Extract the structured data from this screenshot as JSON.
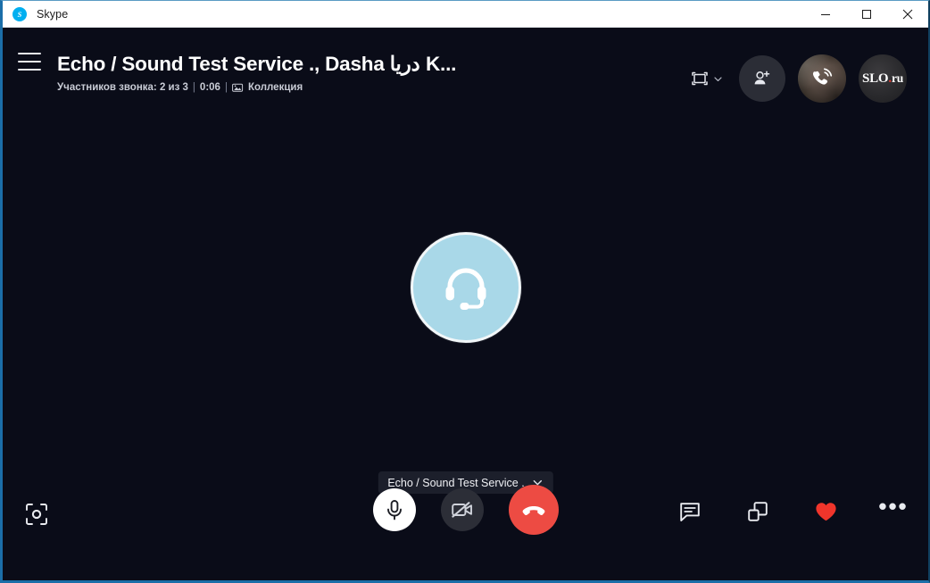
{
  "window": {
    "app_name": "Skype",
    "logo_icon": "skype-logo-icon",
    "controls": {
      "minimize": "minimize-icon",
      "maximize": "maximize-icon",
      "close": "close-icon"
    }
  },
  "header": {
    "menu_icon": "hamburger-menu-icon",
    "call_title": "Echo / Sound Test Service ., Dasha دریا K...",
    "subtitle": {
      "participants": "Участников звонка: 2 из 3",
      "sep1": "|",
      "duration": "0:06",
      "sep2": "|",
      "gallery_icon": "gallery-collection-icon",
      "gallery_label": "Коллекция"
    },
    "actions": {
      "layout_icon": "layout-frame-icon",
      "layout_chevron_icon": "chevron-down-icon",
      "add_people_icon": "add-person-icon",
      "ringing_avatar_icon": "call-ringing-icon",
      "self_avatar_text": "SLO",
      "self_avatar_dot": ".",
      "self_avatar_suffix": "ru"
    }
  },
  "stage": {
    "participant": {
      "avatar_icon": "headset-avatar-icon",
      "avatar_bg_color": "#a9d8e8",
      "name": "Echo / Sound Test Service .",
      "name_chevron_icon": "chevron-down-icon"
    }
  },
  "controls": {
    "snapshot_icon": "snapshot-capture-icon",
    "mic_icon": "microphone-icon",
    "mic_state": "on",
    "camera_icon": "camera-off-icon",
    "camera_state": "off",
    "end_call_icon": "end-call-icon",
    "chat_icon": "chat-bubble-icon",
    "split_view_icon": "split-window-icon",
    "reaction_icon": "heart-icon",
    "more_icon": "more-options-icon",
    "more_glyph": "•••"
  },
  "colors": {
    "app_background": "#0a0c18",
    "accent_blue": "#00aff0",
    "end_call_red": "#ed4b43",
    "heart_red": "#f0352b",
    "window_border": "#1b6ea8"
  }
}
